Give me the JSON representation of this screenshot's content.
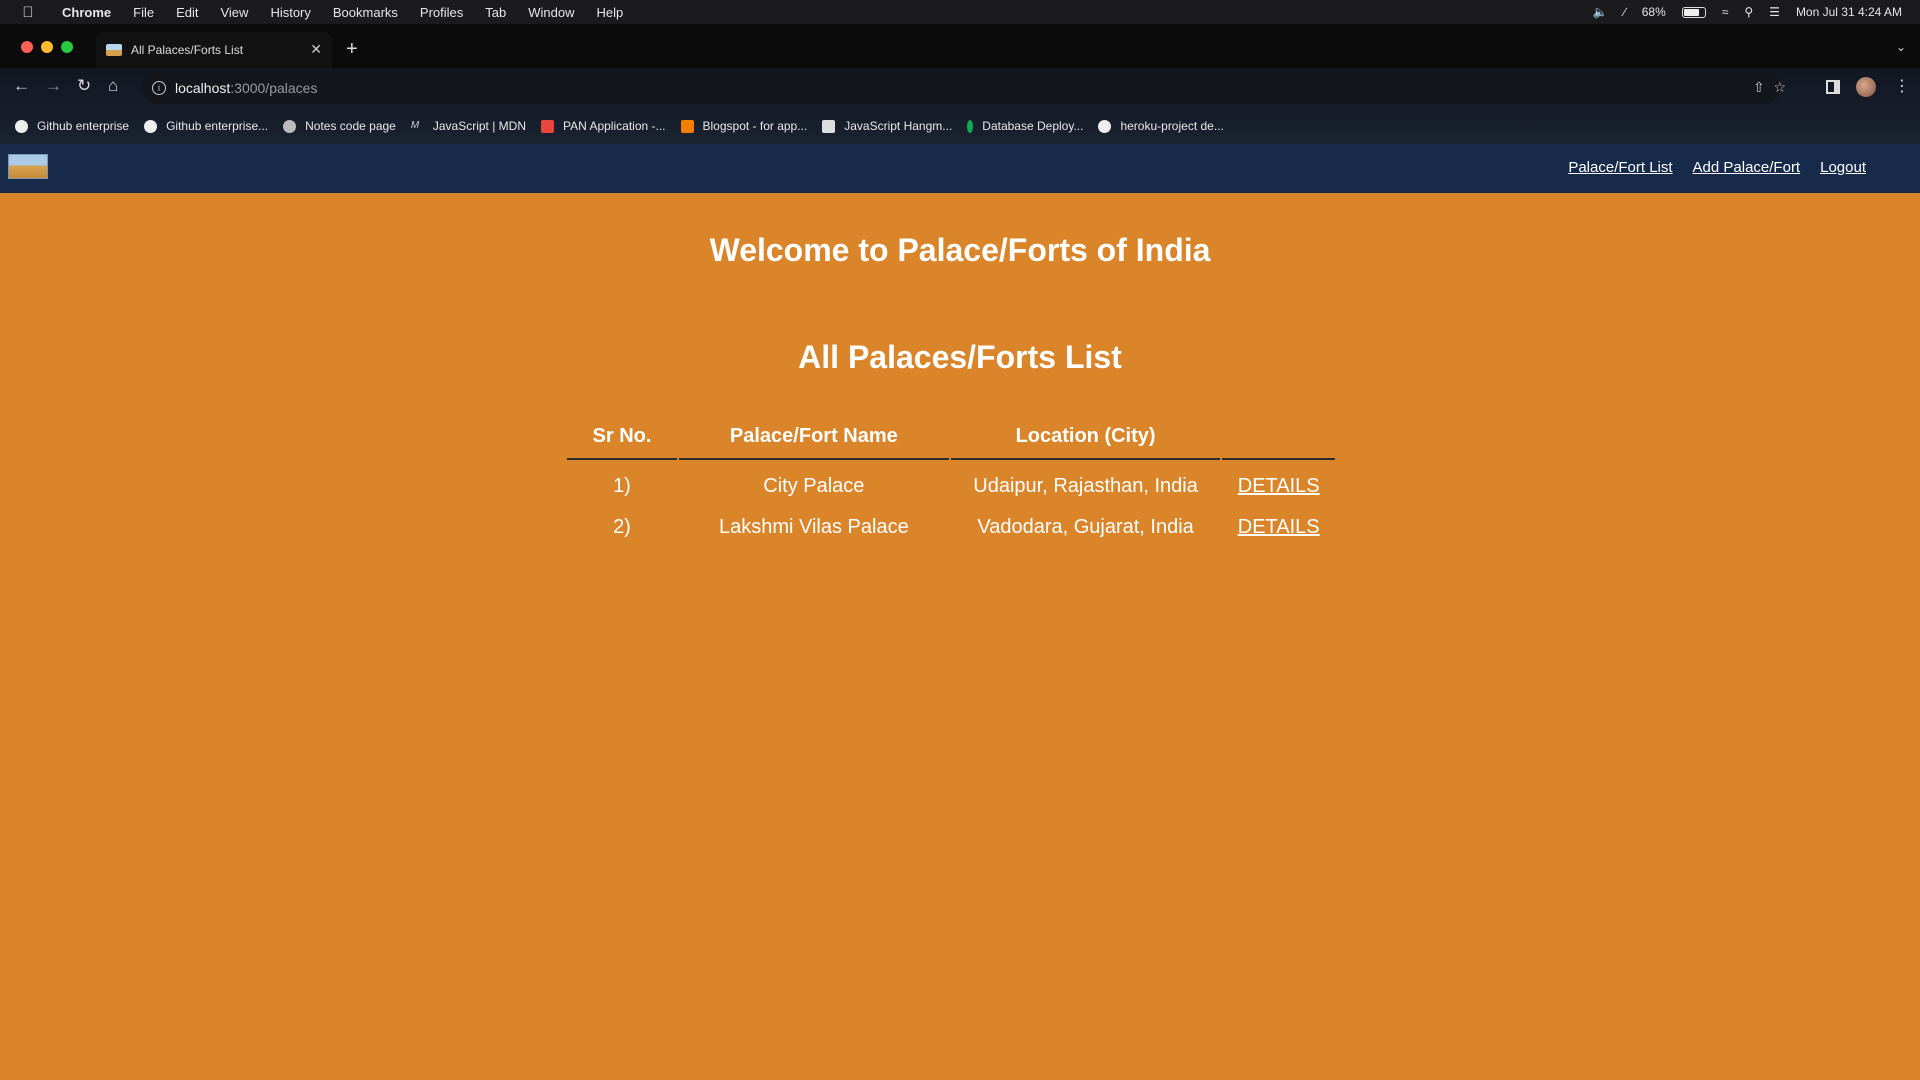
{
  "menubar": {
    "app": "Chrome",
    "items": [
      "File",
      "Edit",
      "View",
      "History",
      "Bookmarks",
      "Profiles",
      "Tab",
      "Window",
      "Help"
    ],
    "battery": "68%",
    "datetime": "Mon Jul 31  4:24 AM"
  },
  "browser": {
    "tab_title": "All Palaces/Forts List",
    "url_host": "localhost",
    "url_path": ":3000/palaces",
    "bookmarks": [
      {
        "label": "Github enterprise",
        "icon": "github-icon"
      },
      {
        "label": "Github enterprise...",
        "icon": "github-icon"
      },
      {
        "label": "Notes code page",
        "icon": "globe-icon"
      },
      {
        "label": "JavaScript | MDN",
        "icon": "mdn-icon"
      },
      {
        "label": "PAN Application -...",
        "icon": "gmail-icon"
      },
      {
        "label": "Blogspot - for app...",
        "icon": "blogger-icon"
      },
      {
        "label": "JavaScript Hangm...",
        "icon": "codepen-icon"
      },
      {
        "label": "Database Deploy...",
        "icon": "mongodb-icon"
      },
      {
        "label": "heroku-project de...",
        "icon": "github-icon"
      }
    ]
  },
  "app": {
    "nav": {
      "list_link": "Palace/Fort List",
      "add_link": "Add Palace/Fort",
      "logout_link": "Logout"
    },
    "heading": "Welcome to Palace/Forts of India",
    "subheading": "All Palaces/Forts List",
    "table": {
      "headers": [
        "Sr No.",
        "Palace/Fort Name",
        "Location (City)",
        ""
      ],
      "rows": [
        {
          "sr": "1)",
          "name": "City Palace",
          "location": "Udaipur, Rajasthan, India",
          "action": "DETAILS"
        },
        {
          "sr": "2)",
          "name": "Lakshmi Vilas Palace",
          "location": "Vadodara, Gujarat, India",
          "action": "DETAILS"
        }
      ]
    }
  },
  "colors": {
    "page_bg": "#da8529",
    "navbar_bg": "#172a4a",
    "text": "#ffffff"
  }
}
